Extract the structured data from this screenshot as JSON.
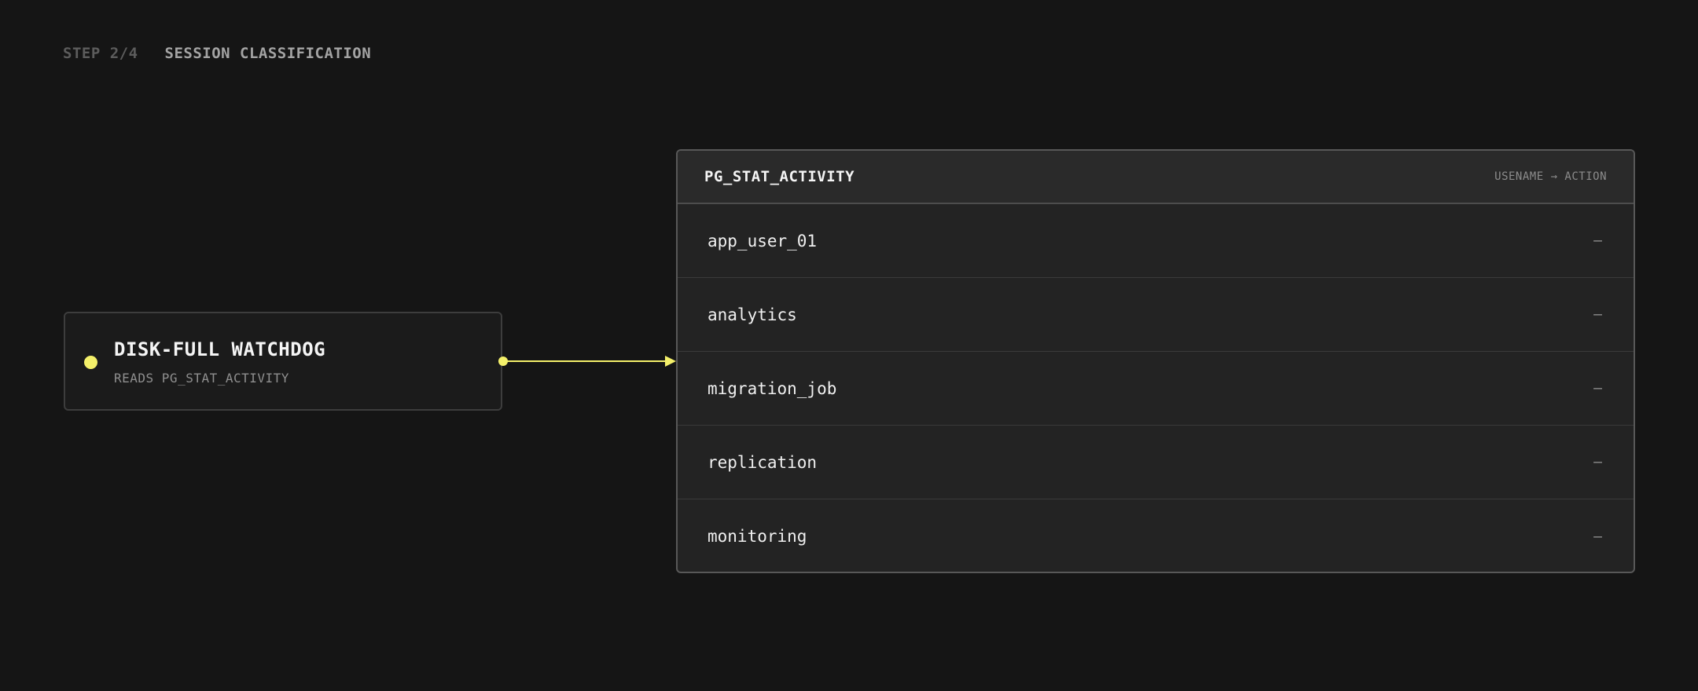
{
  "header": {
    "step": "STEP 2/4",
    "title": "SESSION CLASSIFICATION"
  },
  "source_node": {
    "title": "DISK-FULL WATCHDOG",
    "subtitle": "READS PG_STAT_ACTIVITY",
    "accent_color": "#f4f06a"
  },
  "table": {
    "title": "PG_STAT_ACTIVITY",
    "caption": "USENAME → ACTION",
    "rows": [
      {
        "name": "app_user_01",
        "action": "—"
      },
      {
        "name": "analytics",
        "action": "—"
      },
      {
        "name": "migration_job",
        "action": "—"
      },
      {
        "name": "replication",
        "action": "—"
      },
      {
        "name": "monitoring",
        "action": "—"
      }
    ]
  },
  "colors": {
    "background": "#151515",
    "accent": "#f4f06a"
  }
}
